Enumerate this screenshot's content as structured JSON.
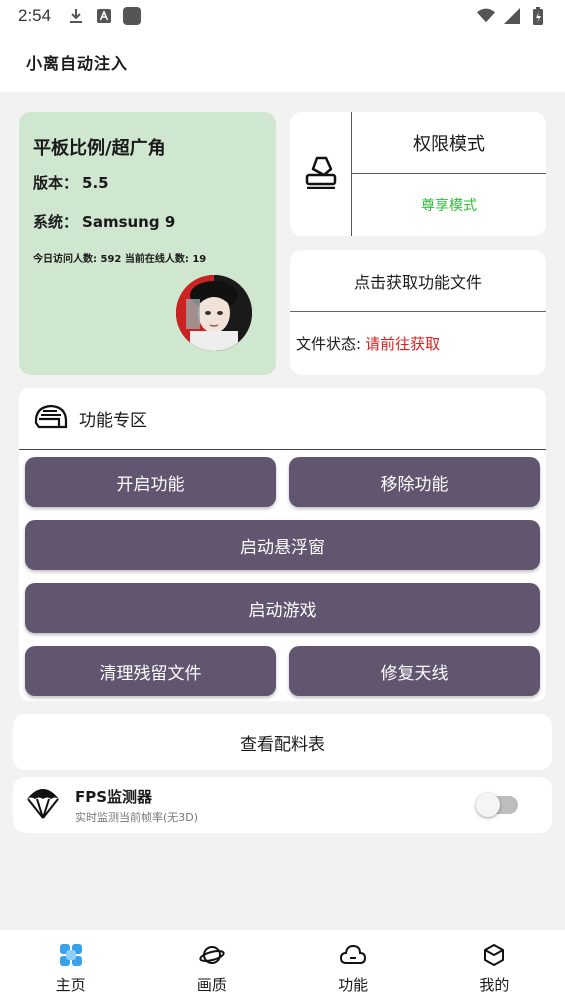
{
  "status_bar": {
    "time": "2:54",
    "icons": [
      "download-icon",
      "font-a-icon",
      "app-square-icon",
      "wifi-icon",
      "cellular-icon",
      "battery-charging-icon"
    ]
  },
  "header": {
    "title": "小离自动注入"
  },
  "info_card": {
    "title": "平板比例/超广角",
    "version_label": "版本：",
    "version_value": "5.5",
    "system_label": "系统：",
    "system_value": "Samsung 9",
    "visits_text": "今日访问人数: 592 当前在线人数: 19",
    "background": "#cfe6cf"
  },
  "mode_card": {
    "icon": "stamp-icon",
    "title": "权限模式",
    "selected_mode": "尊享模式",
    "selected_color": "#2fbf3a"
  },
  "file_card": {
    "get_label": "点击获取功能文件",
    "status_label": "文件状态:",
    "status_value": "请前往获取",
    "status_color": "#e02020"
  },
  "function_zone": {
    "icon": "helmet-icon",
    "title": "功能专区",
    "buttons": {
      "enable": "开启功能",
      "remove": "移除功能",
      "float_window": "启动悬浮窗",
      "start_game": "启动游戏",
      "clean_files": "清理残留文件",
      "fix_antenna": "修复天线"
    },
    "button_color": "#615570"
  },
  "config_table": {
    "label": "查看配料表"
  },
  "fps_monitor": {
    "icon": "parachute-icon",
    "title": "FPS监测器",
    "subtitle": "实时监测当前帧率(无3D)",
    "enabled": false
  },
  "bottom_nav": {
    "items": [
      {
        "label": "主页",
        "icon": "home-icon",
        "active": true
      },
      {
        "label": "画质",
        "icon": "planet-icon",
        "active": false
      },
      {
        "label": "功能",
        "icon": "cloud-icon",
        "active": false
      },
      {
        "label": "我的",
        "icon": "cube-icon",
        "active": false
      }
    ],
    "active_color": "#3aa0e8"
  }
}
